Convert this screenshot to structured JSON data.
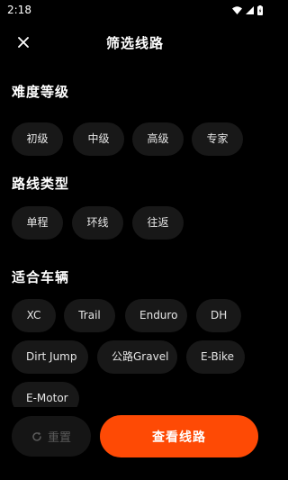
{
  "status": {
    "time": "2:18"
  },
  "header": {
    "title": "筛选线路"
  },
  "sections": {
    "difficulty": {
      "title": "难度等级",
      "chips": [
        "初级",
        "中级",
        "高级",
        "专家"
      ]
    },
    "route_type": {
      "title": "路线类型",
      "chips": [
        "单程",
        "环线",
        "往返"
      ]
    },
    "vehicle": {
      "title": "适合车辆",
      "chips": [
        "XC",
        "Trail",
        "Enduro",
        "DH",
        "Dirt Jump",
        "公路Gravel",
        "E-Bike",
        "E-Motor"
      ]
    }
  },
  "footer": {
    "reset_label": "重置",
    "view_label": "查看线路"
  },
  "colors": {
    "accent": "#fe4a05",
    "chip_bg": "#181818",
    "background": "#000000"
  }
}
